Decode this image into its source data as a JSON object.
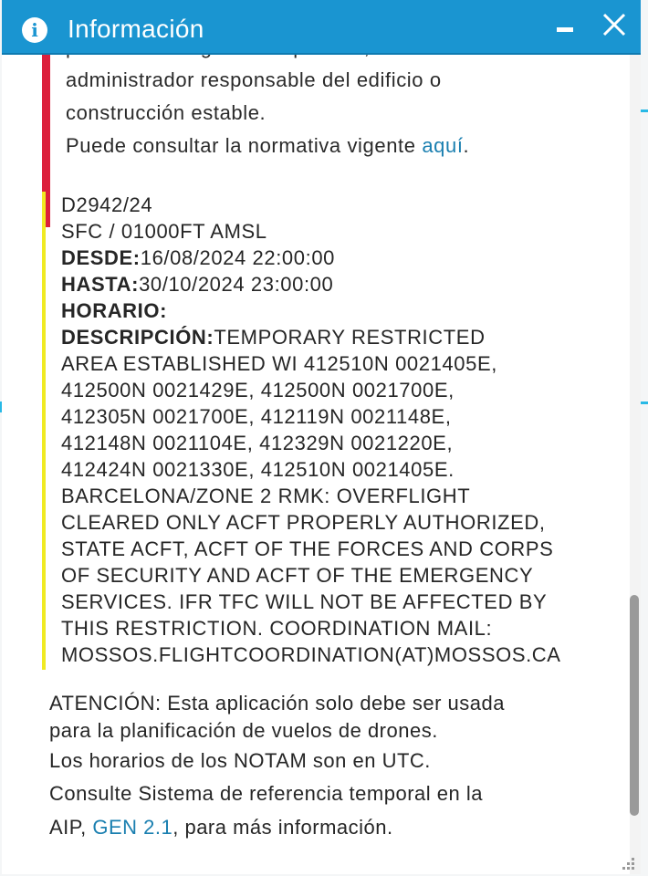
{
  "window": {
    "title": "Información",
    "info_icon_glyph": "i",
    "icons": {
      "info": "info-icon",
      "minimize": "minimize-icon",
      "close": "close-icon"
    },
    "colors": {
      "titlebar": "#1a95d1",
      "warning_bar": "#dc1f3c",
      "notam_bar": "#f0ea22",
      "link": "#1a7fb0"
    }
  },
  "warning": {
    "line1": "permiso del órgano competente, el titular o",
    "line2": "administrador responsable del edificio o",
    "line3": "construcción estable.",
    "line4_text": "Puede consultar la normativa vigente ",
    "line4_link": "aquí",
    "line4_end": "."
  },
  "notam": {
    "id": "D2942/24",
    "altitude": "SFC / 01000FT AMSL",
    "desde_label": "DESDE:",
    "desde_value": "16/08/2024 22:00:00",
    "hasta_label": "HASTA:",
    "hasta_value": "30/10/2024 23:00:00",
    "horario_label": "HORARIO:",
    "descripcion_label": "DESCRIPCIÓN:",
    "descripcion_first": "TEMPORARY RESTRICTED",
    "description_lines": [
      "AREA ESTABLISHED WI 412510N 0021405E,",
      "412500N 0021429E, 412500N 0021700E,",
      "412305N 0021700E, 412119N 0021148E,",
      "412148N 0021104E, 412329N 0021220E,",
      "412424N 0021330E, 412510N 0021405E.",
      "BARCELONA/ZONE 2 RMK: OVERFLIGHT",
      "CLEARED ONLY ACFT PROPERLY AUTHORIZED,",
      "STATE ACFT, ACFT OF THE FORCES AND CORPS",
      "OF SECURITY AND ACFT OF THE EMERGENCY",
      "SERVICES. IFR TFC WILL NOT BE AFFECTED BY",
      "THIS RESTRICTION. COORDINATION MAIL:",
      "MOSSOS.FLIGHTCOORDINATION(AT)MOSSOS.CA"
    ]
  },
  "footer": {
    "line1": "ATENCIÓN: Esta aplicación solo debe ser usada",
    "line2": "para la planificación de vuelos de drones.",
    "line3": "Los horarios de los NOTAM son en UTC.",
    "line4": "Consulte Sistema de referencia temporal en la",
    "line5_start": "AIP, ",
    "line5_link": "GEN 2.1",
    "line5_end": ", para más información."
  }
}
